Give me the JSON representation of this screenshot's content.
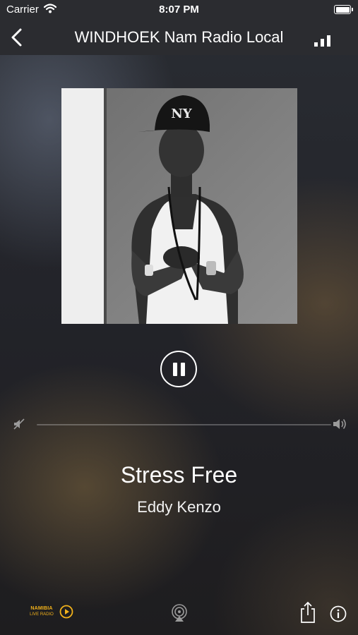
{
  "status_bar": {
    "carrier": "Carrier",
    "time": "8:07 PM"
  },
  "nav": {
    "title": "WINDHOEK Nam Radio Local",
    "back_icon": "chevron-left-icon",
    "signal_icon": "signal-bars-icon"
  },
  "player": {
    "state": "playing",
    "volume_level": 0.0
  },
  "now_playing": {
    "title": "Stress Free",
    "artist": "Eddy Kenzo"
  },
  "bottom_bar": {
    "logo_line1": "NAMIBIA",
    "logo_line2": "LIVE RADIO"
  },
  "colors": {
    "accent": "#f2b21b",
    "bar_background": "#2b2c30"
  }
}
